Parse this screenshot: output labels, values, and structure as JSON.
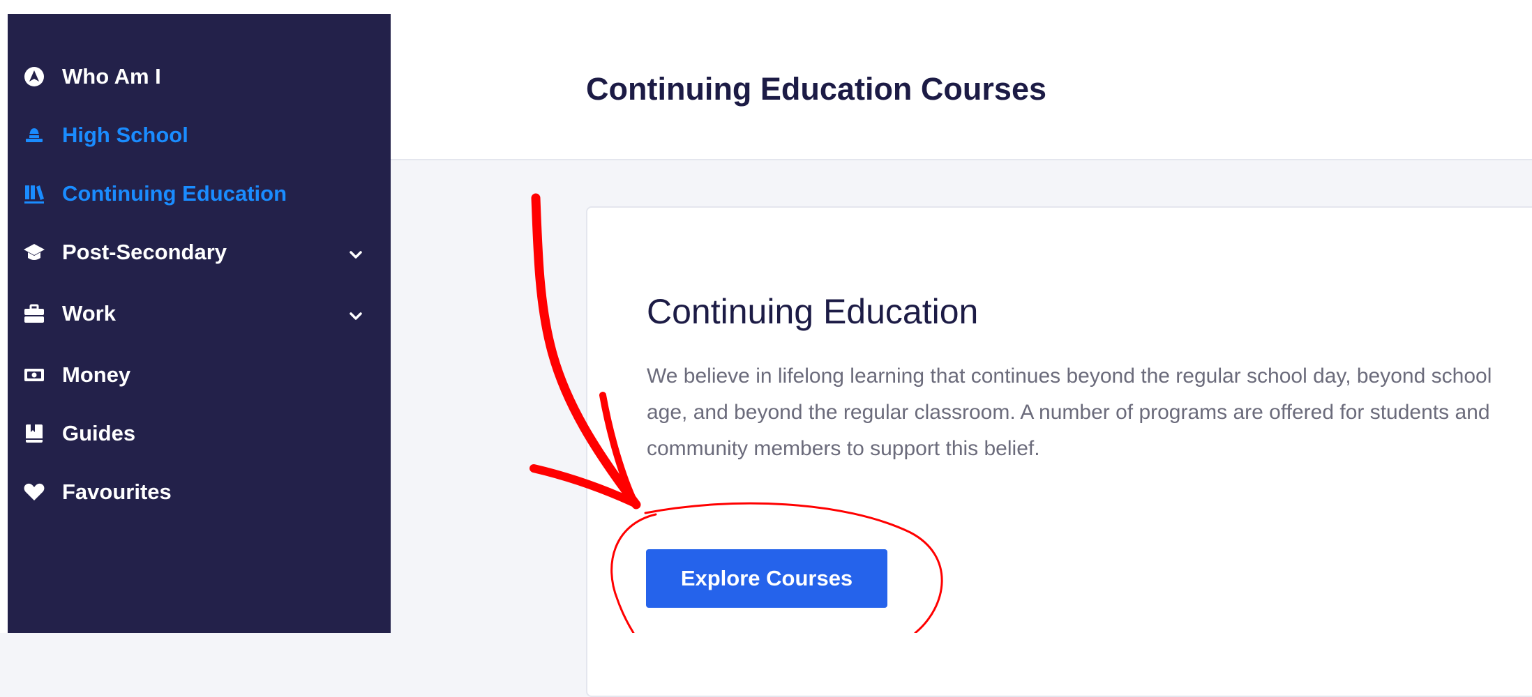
{
  "sidebar": {
    "items": [
      {
        "label": "Who Am I",
        "icon": "compass-icon",
        "active": false
      },
      {
        "label": "High School",
        "icon": "school-bell-icon",
        "active": true
      },
      {
        "label": "Continuing Education",
        "icon": "books-icon",
        "active": true
      },
      {
        "label": "Post-Secondary",
        "icon": "graduation-cap-icon",
        "active": false,
        "expandable": true
      },
      {
        "label": "Work",
        "icon": "briefcase-icon",
        "active": false,
        "expandable": true
      },
      {
        "label": "Money",
        "icon": "money-bill-icon",
        "active": false
      },
      {
        "label": "Guides",
        "icon": "book-icon",
        "active": false
      },
      {
        "label": "Favourites",
        "icon": "heart-icon",
        "active": false
      }
    ]
  },
  "header": {
    "title": "Continuing Education Courses"
  },
  "card": {
    "title": "Continuing Education",
    "description": "We believe in lifelong learning that continues beyond the regular school day, beyond school age, and beyond the regular classroom. A number of programs are offered for students and community members to support this belief.",
    "button_label": "Explore Courses"
  },
  "colors": {
    "sidebar_bg": "#23214a",
    "active_link": "#1a8cff",
    "primary_button": "#2563eb",
    "annotation": "#ff0000"
  }
}
